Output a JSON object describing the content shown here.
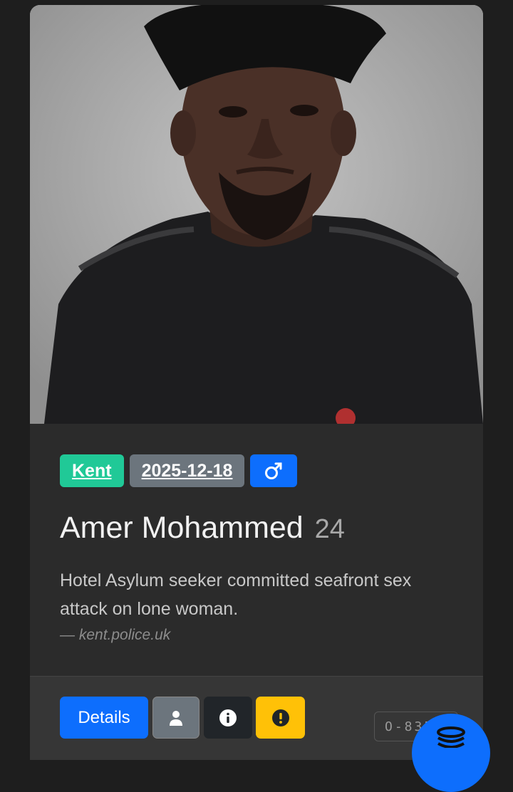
{
  "profile": {
    "region": "Kent",
    "date": "2025-12-18",
    "gender_icon": "male-symbol-icon",
    "name": "Amer Mohammed",
    "age": "24",
    "description": "Hotel Asylum seeker committed seafront sex attack on lone woman.",
    "source": "— kent.police.uk"
  },
  "actions": {
    "details_label": "Details",
    "person_icon": "person-icon",
    "info_icon": "info-icon",
    "warning_icon": "exclamation-icon"
  },
  "reference_code": "O-835",
  "fab_icon": "stack-icon",
  "colors": {
    "region_badge": "#20c997",
    "date_badge": "#6c757d",
    "gender_badge": "#0d6efd",
    "details_button": "#0d6efd",
    "warning_button": "#ffc107",
    "card_background": "#2b2b2b"
  }
}
